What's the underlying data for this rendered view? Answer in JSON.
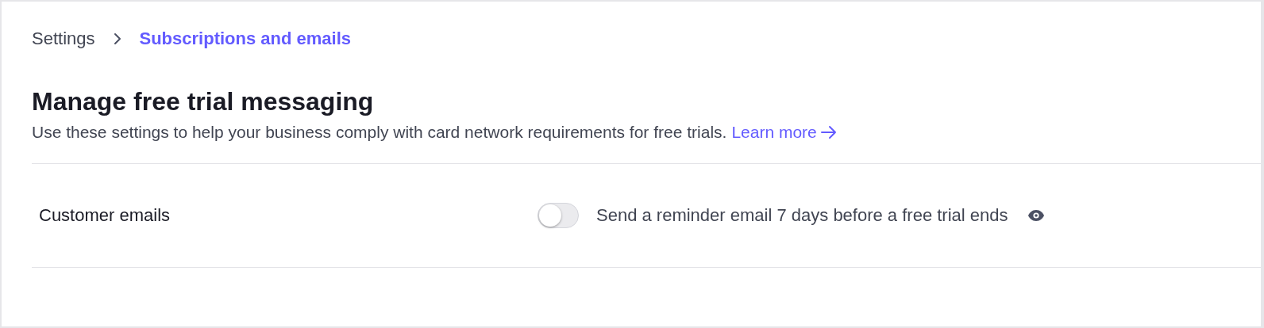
{
  "breadcrumb": [
    {
      "label": "Settings",
      "current": false
    },
    {
      "label": "Subscriptions and emails",
      "current": true
    }
  ],
  "heading": "Manage free trial messaging",
  "description": "Use these settings to help your business comply with card network requirements for free trials.",
  "learn_more": "Learn more",
  "settings": [
    {
      "label": "Customer emails",
      "option": "Send a reminder email 7 days before a free trial ends",
      "on": false
    }
  ]
}
